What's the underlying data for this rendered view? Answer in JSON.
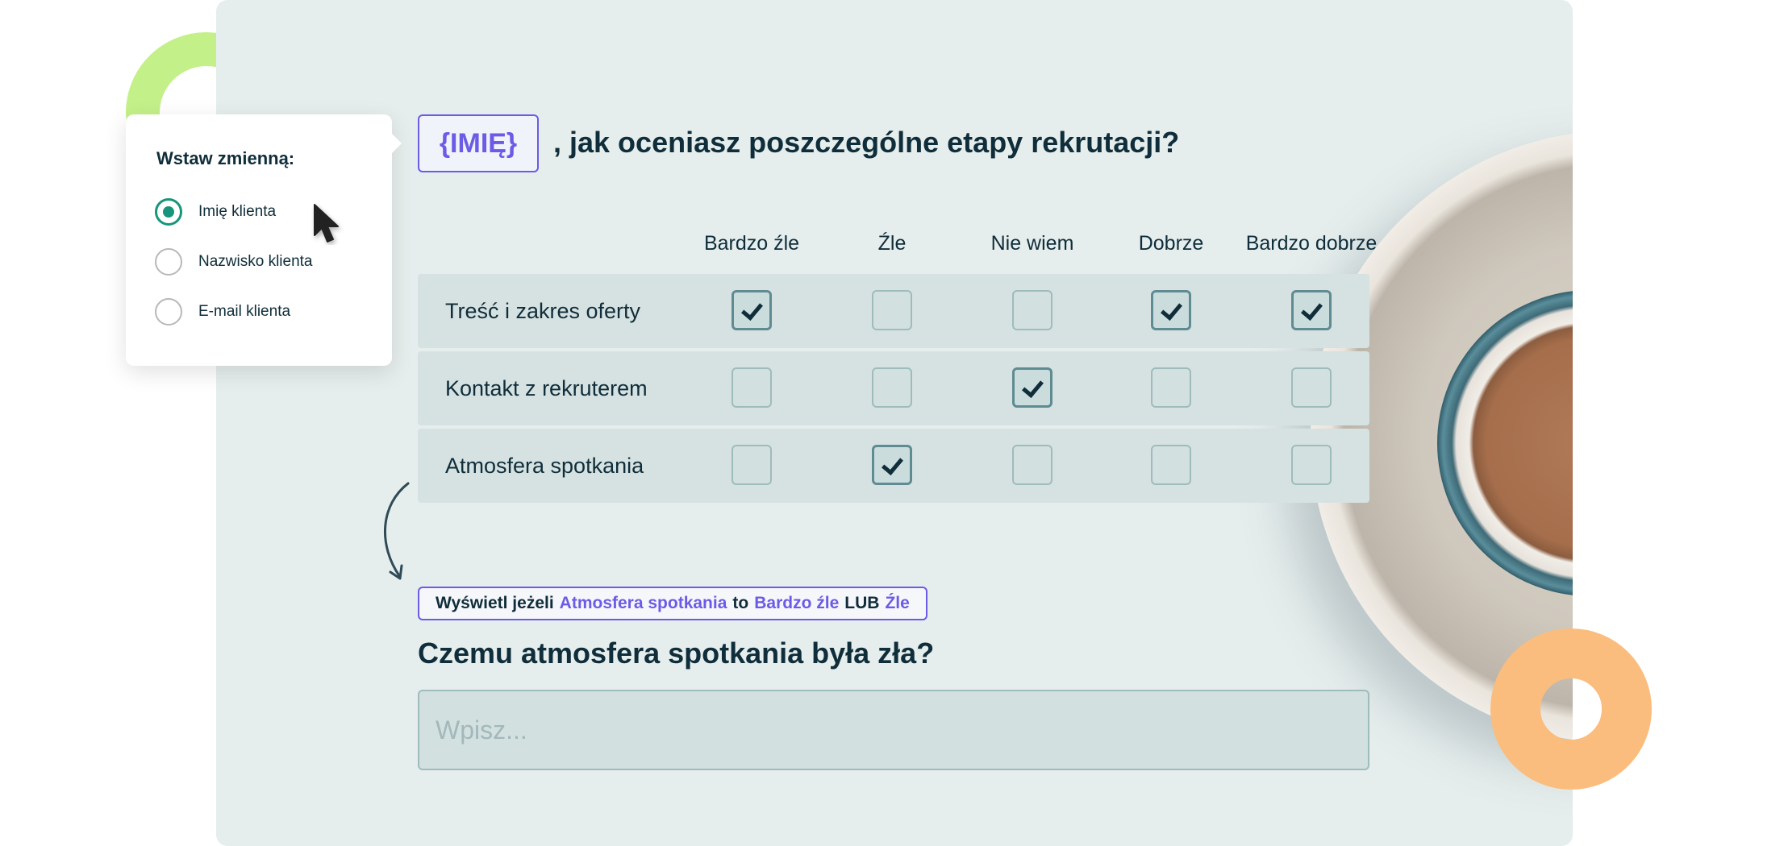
{
  "popup": {
    "title": "Wstaw zmienną:",
    "options": [
      {
        "label": "Imię klienta",
        "selected": true
      },
      {
        "label": "Nazwisko klienta",
        "selected": false
      },
      {
        "label": "E-mail klienta",
        "selected": false
      }
    ]
  },
  "question1": {
    "variable": "{IMIĘ}",
    "text": ", jak oceniasz poszczególne etapy rekrutacji?"
  },
  "matrix": {
    "columns": [
      "Bardzo źle",
      "Źle",
      "Nie wiem",
      "Dobrze",
      "Bardzo dobrze"
    ],
    "rows": [
      {
        "label": "Treść i zakres oferty",
        "checked": [
          true,
          false,
          false,
          true,
          true
        ]
      },
      {
        "label": "Kontakt z rekruterem",
        "checked": [
          false,
          false,
          true,
          false,
          false
        ]
      },
      {
        "label": "Atmosfera spotkania",
        "checked": [
          false,
          true,
          false,
          false,
          false
        ]
      }
    ]
  },
  "condition": {
    "prefix": "Wyświetl jeżeli",
    "field": "Atmosfera spotkania",
    "op": "to",
    "value1": "Bardzo źle",
    "joiner": "LUB",
    "value2": "Źle"
  },
  "question2": {
    "text": "Czemu atmosfera spotkania była zła?",
    "placeholder": "Wpisz..."
  },
  "colors": {
    "accent": "#6b5be6",
    "radio_checked": "#17957c",
    "panel_bg": "#e6eeed",
    "green_arc": "#c4f08a",
    "orange_ring": "#fbbd7d"
  },
  "icons": [
    "cursor-arrow-icon",
    "curved-arrow-icon",
    "check-icon"
  ]
}
